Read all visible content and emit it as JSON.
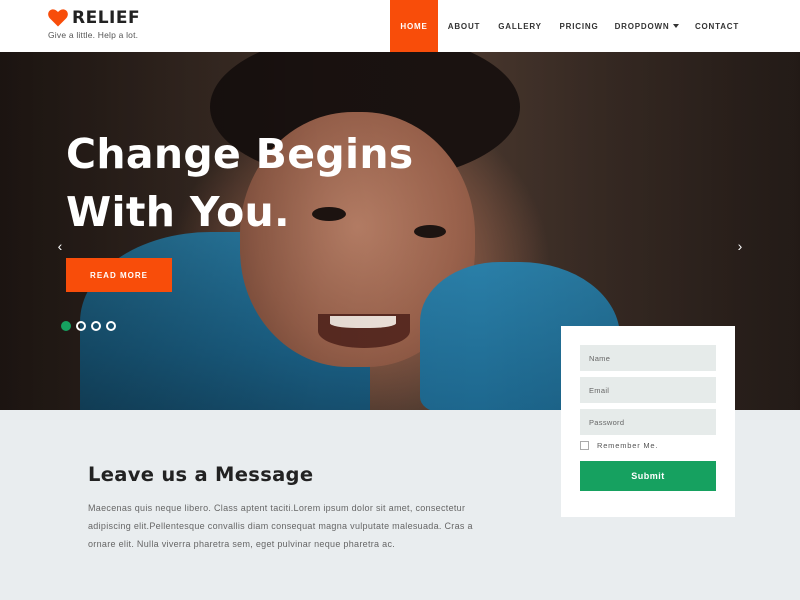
{
  "brand": {
    "name": "RELIEF",
    "tagline": "Give a little. Help a lot.",
    "accent_color": "#f84d0a",
    "heart_icon": "heart-icon"
  },
  "nav": {
    "home": "HOME",
    "about": "ABOUT",
    "gallery": "GALLERY",
    "pricing": "PRICING",
    "dropdown": "DROPDOWN",
    "contact": "CONTACT",
    "active_item": "HOME"
  },
  "hero": {
    "title_line1": "Change Begins",
    "title_line2": "With You.",
    "cta_label": "READ MORE",
    "prev_arrow": "‹",
    "next_arrow": "›",
    "slides_total": 4,
    "active_slide": 1,
    "active_dot_color": "#16a160"
  },
  "form": {
    "name_placeholder": "Name",
    "email_placeholder": "Email",
    "password_placeholder": "Password",
    "remember_label": "Remember Me.",
    "submit_label": "Submit",
    "submit_color": "#16a160"
  },
  "message": {
    "title": "Leave us a Message",
    "body": "Maecenas quis neque libero. Class aptent taciti.Lorem ipsum dolor sit amet, consectetur adipiscing elit.Pellentesque convallis diam consequat magna vulputate malesuada. Cras a ornare elit. Nulla viverra pharetra sem, eget pulvinar neque pharetra ac."
  }
}
